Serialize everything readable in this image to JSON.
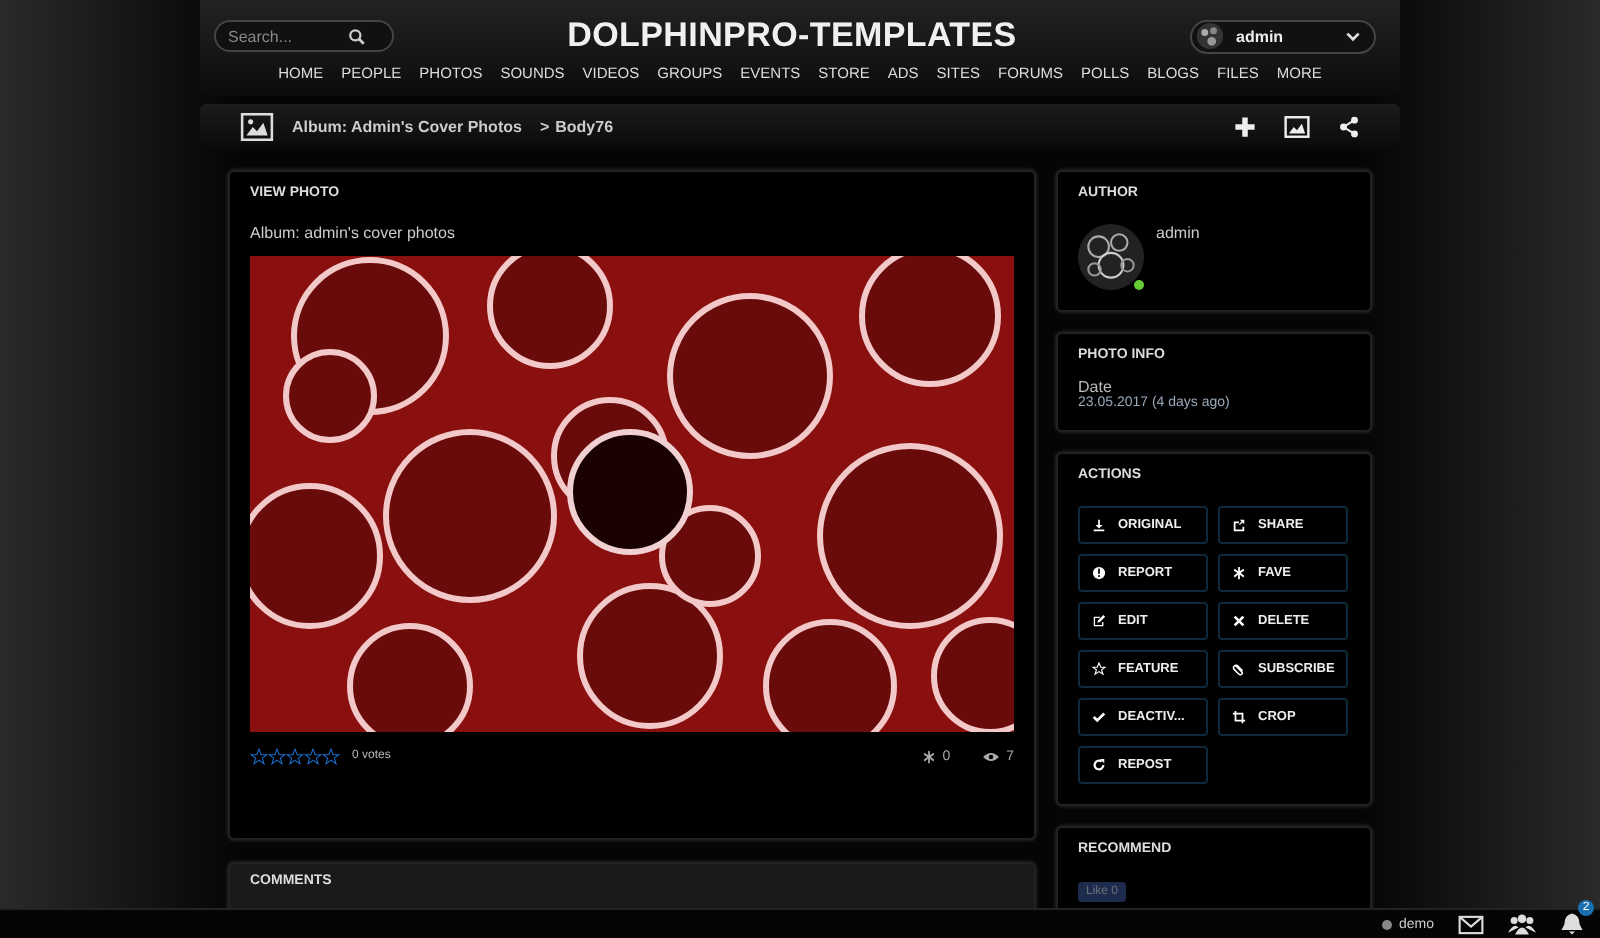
{
  "header": {
    "search": {
      "placeholder": "Search..."
    },
    "logo": "DOLPHINPRO-TEMPLATES",
    "user": {
      "name": "admin"
    }
  },
  "nav": [
    "HOME",
    "PEOPLE",
    "PHOTOS",
    "SOUNDS",
    "VIDEOS",
    "GROUPS",
    "EVENTS",
    "STORE",
    "ADS",
    "SITES",
    "FORUMS",
    "POLLS",
    "BLOGS",
    "FILES",
    "MORE"
  ],
  "breadcrumb": {
    "album": "Album: Admin's Cover Photos",
    "separator": ">",
    "photo": "Body76"
  },
  "view_photo": {
    "title": "VIEW PHOTO",
    "album": "Album: admin's cover photos",
    "stars": 0,
    "votes": "0 votes",
    "favorites": "0",
    "views": "7"
  },
  "comments": {
    "title": "COMMENTS"
  },
  "author": {
    "title": "AUTHOR",
    "name": "admin",
    "online": true
  },
  "photo_info": {
    "title": "PHOTO INFO",
    "label": "Date",
    "value": "23.05.2017 (4 days ago)"
  },
  "actions": {
    "title": "ACTIONS",
    "buttons": [
      "ORIGINAL",
      "SHARE",
      "REPORT",
      "FAVE",
      "EDIT",
      "DELETE",
      "FEATURE",
      "SUBSCRIBE",
      "DEACTIV...",
      "CROP",
      "REPOST"
    ]
  },
  "recommend": {
    "title": "RECOMMEND",
    "like": "Like 0"
  },
  "bottom_bar": {
    "user": "demo",
    "online": false,
    "notifications": "2"
  }
}
